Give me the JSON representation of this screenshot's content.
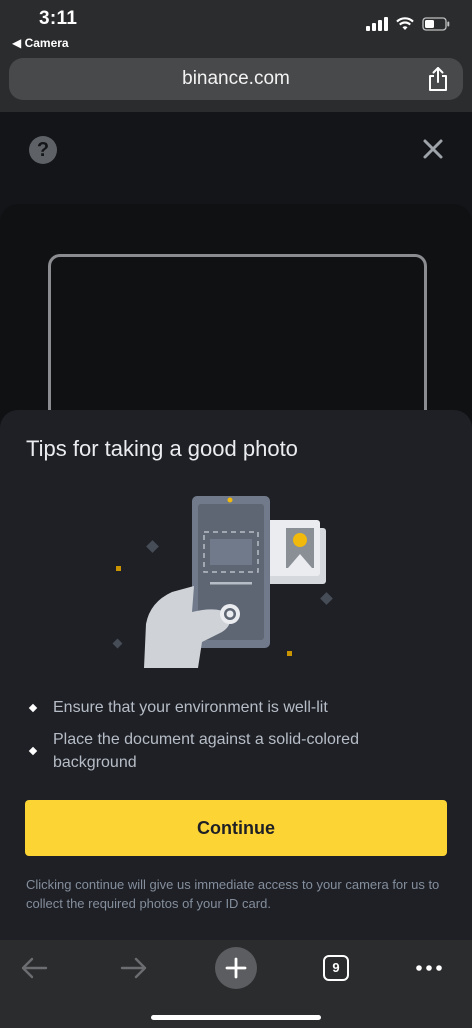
{
  "status_bar": {
    "time": "3:11",
    "back_label": "◀ Camera"
  },
  "browser": {
    "url": "binance.com",
    "tab_count": "9"
  },
  "page": {
    "help_symbol": "?",
    "sheet": {
      "title": "Tips for taking a good photo",
      "tips": [
        "Ensure that your environment is well-lit",
        "Place the document against a solid-colored background"
      ],
      "continue_label": "Continue",
      "disclaimer": "Clicking continue will give us immediate access to your camera for us to collect the required photos of your ID card."
    }
  },
  "colors": {
    "accent": "#fcd535",
    "sheet_bg": "#1e2026",
    "page_bg": "#141518",
    "text_secondary": "#b7bdc6"
  },
  "icons": [
    "signal-icon",
    "wifi-icon",
    "battery-icon",
    "share-icon",
    "help-icon",
    "close-icon",
    "back-arrow-icon",
    "forward-arrow-icon",
    "new-tab-icon",
    "tabs-icon",
    "more-icon"
  ]
}
